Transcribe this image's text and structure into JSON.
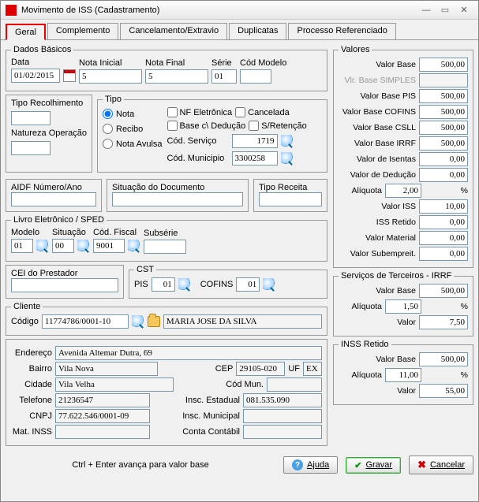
{
  "window": {
    "title": "Movimento de ISS (Cadastramento)"
  },
  "tabs": [
    "Geral",
    "Complemento",
    "Cancelamento/Extravio",
    "Duplicatas",
    "Processo Referenciado"
  ],
  "basic": {
    "legend": "Dados Básicos",
    "data_lbl": "Data",
    "data_val": "01/02/2015",
    "nota_ini_lbl": "Nota Inicial",
    "nota_ini_val": "5",
    "nota_fin_lbl": "Nota Final",
    "nota_fin_val": "5",
    "serie_lbl": "Série",
    "serie_val": "01",
    "cod_mod_lbl": "Cód Modelo",
    "cod_mod_val": ""
  },
  "recol": {
    "tipo_lbl": "Tipo Recolhimento",
    "tipo_val": "",
    "nat_lbl": "Natureza Operação",
    "nat_val": ""
  },
  "tipo": {
    "legend": "Tipo",
    "nota": "Nota",
    "recibo": "Recibo",
    "avulsa": "Nota Avulsa",
    "nf_eletronica": "NF Eletrônica",
    "cancelada": "Cancelada",
    "base_deducao": "Base c\\ Dedução",
    "s_retencao": "S/Retenção",
    "cod_serv_lbl": "Cód. Serviço",
    "cod_serv_val": "1719",
    "cod_mun_lbl": "Cód. Municipio",
    "cod_mun_val": "3300258"
  },
  "aidf": {
    "lbl": "AIDF Número/Ano",
    "val": ""
  },
  "sitdoc": {
    "lbl": "Situação do Documento",
    "val": ""
  },
  "tiporec": {
    "lbl": "Tipo Receita",
    "val": ""
  },
  "sped": {
    "legend": "Livro Eletrônico / SPED",
    "modelo_lbl": "Modelo",
    "modelo_val": "01",
    "sit_lbl": "Situação",
    "sit_val": "00",
    "cfisc_lbl": "Cód. Fiscal",
    "cfisc_val": "9001",
    "subserie_lbl": "Subsérie",
    "subserie_val": ""
  },
  "cei": {
    "lbl": "CEI do Prestador",
    "val": ""
  },
  "cst": {
    "legend": "CST",
    "pis_lbl": "PIS",
    "pis_val": "01",
    "cofins_lbl": "COFINS",
    "cofins_val": "01"
  },
  "cliente": {
    "legend": "Cliente",
    "codigo_lbl": "Código",
    "codigo_val": "11774786/0001-10",
    "nome": "MARIA JOSE DA SILVA",
    "end_lbl": "Endereço",
    "end_val": "Avenida Altemar Dutra, 69",
    "bairro_lbl": "Bairro",
    "bairro_val": "Vila Nova",
    "cep_lbl": "CEP",
    "cep_val": "29105-020",
    "uf_lbl": "UF",
    "uf_val": "EX",
    "cidade_lbl": "Cidade",
    "cidade_val": "Vila Velha",
    "codmun_lbl": "Cód Mun.",
    "codmun_val": "",
    "tel_lbl": "Telefone",
    "tel_val": "21236547",
    "ie_lbl": "Insc. Estadual",
    "ie_val": "081.535.090",
    "cnpj_lbl": "CNPJ",
    "cnpj_val": "77.622.546/0001-09",
    "im_lbl": "Insc. Municipal",
    "im_val": "",
    "matinss_lbl": "Mat. INSS",
    "matinss_val": "",
    "conta_lbl": "Conta Contábil",
    "conta_val": ""
  },
  "valores": {
    "legend": "Valores",
    "base_lbl": "Valor Base",
    "base": "500,00",
    "simples_lbl": "Vlr. Base SIMPLES",
    "simples": "",
    "pis_lbl": "Valor Base PIS",
    "pis": "500,00",
    "cofins_lbl": "Valor Base COFINS",
    "cofins": "500,00",
    "csll_lbl": "Valor Base CSLL",
    "csll": "500,00",
    "irrf_lbl": "Valor Base IRRF",
    "irrf": "500,00",
    "isentas_lbl": "Valor de Isentas",
    "isentas": "0,00",
    "ded_lbl": "Valor de Dedução",
    "ded": "0,00",
    "aliq_lbl": "Alíquota",
    "aliq": "2,00",
    "iss_lbl": "Valor ISS",
    "iss": "10,00",
    "issret_lbl": "ISS Retido",
    "issret": "0,00",
    "mat_lbl": "Valor Material",
    "mat": "0,00",
    "sub_lbl": "Valor Subempreit.",
    "sub": "0,00"
  },
  "terceiros": {
    "legend": "Serviços de Terceiros - IRRF",
    "base_lbl": "Valor Base",
    "base": "500,00",
    "aliq_lbl": "Alíquota",
    "aliq": "1,50",
    "valor_lbl": "Valor",
    "valor": "7,50"
  },
  "inss": {
    "legend": "INSS Retido",
    "base_lbl": "Valor Base",
    "base": "500,00",
    "aliq_lbl": "Alíquota",
    "aliq": "11,00",
    "valor_lbl": "Valor",
    "valor": "55,00"
  },
  "footer": {
    "hint": "Ctrl + Enter avança para valor base",
    "ajuda": "Ajuda",
    "gravar": "Gravar",
    "cancelar": "Cancelar"
  },
  "pct": "%"
}
